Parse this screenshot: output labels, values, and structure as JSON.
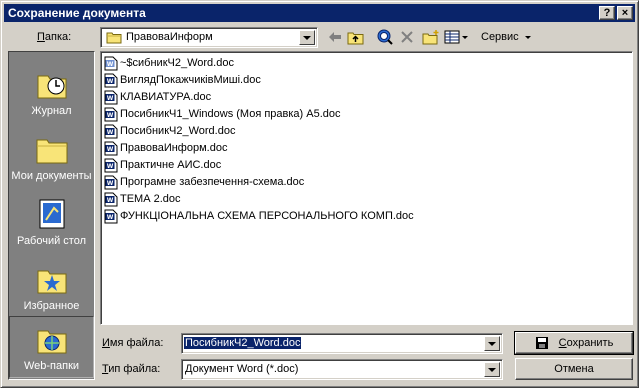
{
  "window": {
    "title": "Сохранение документа",
    "help_label": "?",
    "close_label": "×"
  },
  "toolbar": {
    "folder_label": "Папка:",
    "folder_label_key": "П",
    "folder_label_rest": "апка:",
    "current_folder": "ПравоваИнформ",
    "service_label": "Сервис"
  },
  "places": [
    {
      "label": "Журнал",
      "icon": "history-folder-icon"
    },
    {
      "label": "Мои документы",
      "icon": "my-documents-folder-icon"
    },
    {
      "label": "Рабочий стол",
      "icon": "desktop-icon"
    },
    {
      "label": "Избранное",
      "icon": "favorites-folder-icon"
    },
    {
      "label": "Web-папки",
      "icon": "web-folders-icon"
    }
  ],
  "files": [
    {
      "name": "~$сибникЧ2_Word.doc",
      "temp": true
    },
    {
      "name": "ВиглядПокажчиківМиші.doc"
    },
    {
      "name": "КЛАВИАТУРА.doc"
    },
    {
      "name": "ПосибникЧ1_Windows (Моя правка) А5.doc"
    },
    {
      "name": "ПосибникЧ2_Word.doc"
    },
    {
      "name": "ПравоваИнформ.doc"
    },
    {
      "name": "Практичне АИС.doc"
    },
    {
      "name": "Програмне забезпечення-схема.doc"
    },
    {
      "name": "ТЕМА 2.doc"
    },
    {
      "name": "ФУНКЦІОНАЛЬНА СХЕМА ПЕРСОНАЛЬНОГО КОМП.doc"
    }
  ],
  "filename": {
    "label_key": "И",
    "label_rest": "мя файла:",
    "value": "ПосибникЧ2_Word.doc"
  },
  "filetype": {
    "label_key": "Т",
    "label_rest": "ип файла:",
    "value": "Документ Word (*.doc)"
  },
  "buttons": {
    "save_key": "С",
    "save_rest": "охранить",
    "cancel": "Отмена"
  },
  "colors": {
    "title_bar": "#0a246a",
    "dialog_face": "#d4d0c8",
    "places_bar": "#808080",
    "selection": "#0a246a"
  }
}
